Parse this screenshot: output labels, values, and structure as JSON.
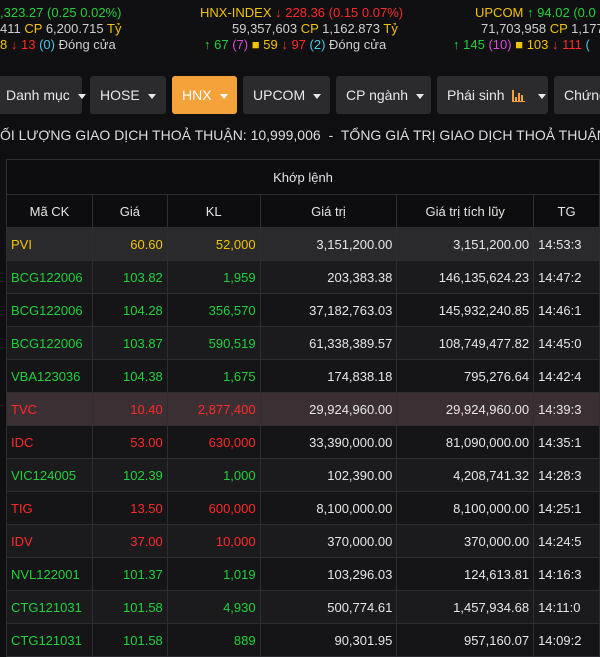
{
  "ticker": {
    "left": {
      "line1_value": ",323.27",
      "line1_change": "(0.25 0.02%)",
      "line2_volume": "411",
      "line2_cp_label": "CP",
      "line2_value": "6,200.715",
      "line2_unit": "Tỷ",
      "line3_ceil": "8",
      "line3_down": "13",
      "line3_ref": "(0)",
      "line3_status": "Đóng cửa"
    },
    "center": {
      "name": "HNX-INDEX",
      "value": "228.36",
      "change": "(0.15 0.07%)",
      "volume": "59,357,603",
      "cp_label": "CP",
      "cp_value": "1,162.873",
      "unit": "Tỷ",
      "up": "67",
      "up_ceil": "(7)",
      "ref": "59",
      "down": "97",
      "down_floor": "(2)",
      "status": "Đóng cửa"
    },
    "right": {
      "name": "UPCOM",
      "value": "94.02",
      "change": "(0.0",
      "volume": "71,703,958",
      "cp_label": "CP",
      "cp_value": "1,177",
      "up": "145",
      "up_ceil": "(10)",
      "ref": "103",
      "down": "111",
      "down_floor": "("
    }
  },
  "tabs": [
    {
      "label": "Danh mục",
      "active": false
    },
    {
      "label": "HOSE",
      "active": false
    },
    {
      "label": "HNX",
      "active": true
    },
    {
      "label": "UPCOM",
      "active": false
    },
    {
      "label": "CP ngành",
      "active": false
    },
    {
      "label": "Phái sinh",
      "active": false
    },
    {
      "label": "Chứng",
      "active": false
    }
  ],
  "banner": {
    "volume_label": "ỐI LƯỢNG GIAO DỊCH THOẢ THUẬN:",
    "volume_value": "10,999,006",
    "separator": "-",
    "value_label": "TỔNG GIÁ TRỊ GIAO DỊCH THOẢ THUẬN:"
  },
  "table": {
    "group_header": "Khớp lệnh",
    "headers": [
      "Mã CK",
      "Giá",
      "KL",
      "Giá trị",
      "Giá trị tích lũy",
      "TG"
    ],
    "rows": [
      {
        "sym": "PVI",
        "price": "60.60",
        "vol": "52,000",
        "val": "3,151,200.00",
        "acc": "3,151,200.00",
        "time": "14:53:3",
        "color": "ref",
        "style": "r-first"
      },
      {
        "sym": "BCG122006",
        "price": "103.82",
        "vol": "1,959",
        "val": "203,383.38",
        "acc": "146,135,624.23",
        "time": "14:47:2",
        "color": "up",
        "style": "r-even"
      },
      {
        "sym": "BCG122006",
        "price": "104.28",
        "vol": "356,570",
        "val": "37,182,763.03",
        "acc": "145,932,240.85",
        "time": "14:46:1",
        "color": "up",
        "style": "r-odd"
      },
      {
        "sym": "BCG122006",
        "price": "103.87",
        "vol": "590,519",
        "val": "61,338,389.57",
        "acc": "108,749,477.82",
        "time": "14:45:0",
        "color": "up",
        "style": "r-even"
      },
      {
        "sym": "VBA123036",
        "price": "104.38",
        "vol": "1,675",
        "val": "174,838.18",
        "acc": "795,276.64",
        "time": "14:42:4",
        "color": "up",
        "style": "r-odd"
      },
      {
        "sym": "TVC",
        "price": "10.40",
        "vol": "2,877,400",
        "val": "29,924,960.00",
        "acc": "29,924,960.00",
        "time": "14:39:3",
        "color": "down",
        "style": "r-sel"
      },
      {
        "sym": "IDC",
        "price": "53.00",
        "vol": "630,000",
        "val": "33,390,000.00",
        "acc": "81,090,000.00",
        "time": "14:35:1",
        "color": "down",
        "style": "r-odd"
      },
      {
        "sym": "VIC124005",
        "price": "102.39",
        "vol": "1,000",
        "val": "102,390.00",
        "acc": "4,208,741.32",
        "time": "14:28:3",
        "color": "up",
        "style": "r-even"
      },
      {
        "sym": "TIG",
        "price": "13.50",
        "vol": "600,000",
        "val": "8,100,000.00",
        "acc": "8,100,000.00",
        "time": "14:25:1",
        "color": "down",
        "style": "r-odd"
      },
      {
        "sym": "IDV",
        "price": "37.00",
        "vol": "10,000",
        "val": "370,000.00",
        "acc": "370,000.00",
        "time": "14:24:5",
        "color": "down",
        "style": "r-even"
      },
      {
        "sym": "NVL122001",
        "price": "101.37",
        "vol": "1,019",
        "val": "103,296.03",
        "acc": "124,613.81",
        "time": "14:16:3",
        "color": "up",
        "style": "r-odd"
      },
      {
        "sym": "CTG121031",
        "price": "101.58",
        "vol": "4,930",
        "val": "500,774.61",
        "acc": "1,457,934.68",
        "time": "14:11:0",
        "color": "up",
        "style": "r-even"
      },
      {
        "sym": "CTG121031",
        "price": "101.58",
        "vol": "889",
        "val": "90,301.95",
        "acc": "957,160.07",
        "time": "14:09:2",
        "color": "up",
        "style": "r-odd"
      }
    ]
  },
  "colors": {
    "up": "#20d13a",
    "down": "#ff2a2a",
    "ref": "#f0c400",
    "active_tab": "#f6a23a"
  }
}
